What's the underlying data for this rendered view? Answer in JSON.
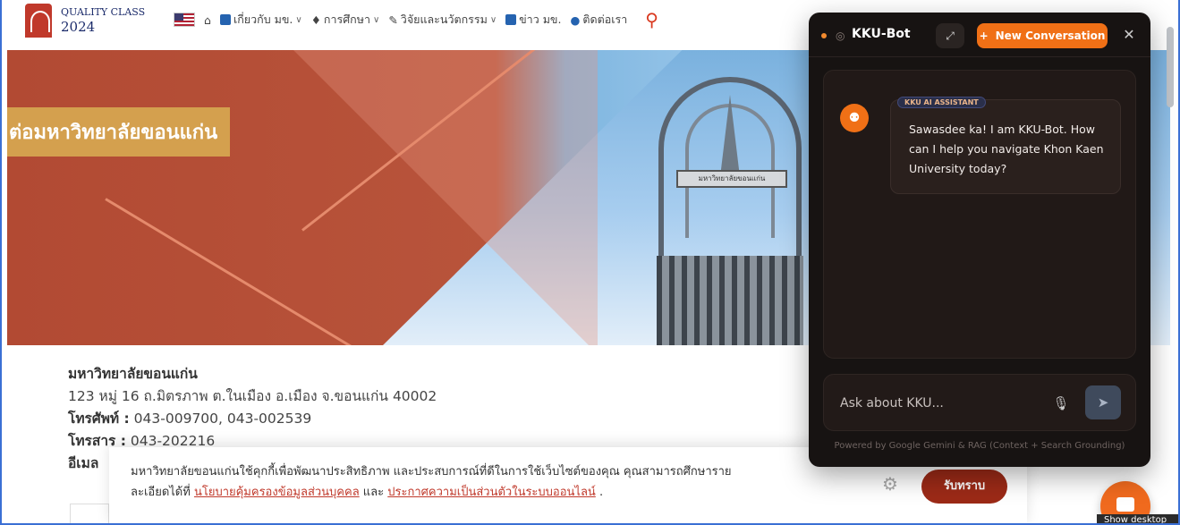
{
  "header": {
    "logo_quality": "QUALITY CLASS",
    "logo_year": "2024",
    "nav": [
      {
        "label": "เกี่ยวกับ มข.",
        "has_dropdown": true
      },
      {
        "label": "การศึกษา",
        "has_dropdown": true
      },
      {
        "label": "วิจัยและนวัตกรรม",
        "has_dropdown": true
      },
      {
        "label": "ข่าว มข.",
        "has_dropdown": false
      },
      {
        "label": "ติดต่อเรา",
        "has_dropdown": false
      }
    ],
    "icons": [
      "us-flag-icon",
      "home-icon",
      "search-icon"
    ]
  },
  "hero": {
    "title": "ต่อมหาวิทยาลัยขอนแก่น",
    "monument_plate": "มหาวิทยาลัยขอนแก่น"
  },
  "address": {
    "name": "มหาวิทยาลัยขอนแก่น",
    "line1": "123 หมู่ 16 ถ.มิตรภาพ ต.ในเมือง อ.เมือง จ.ขอนแก่น 40002",
    "phone_label": "โทรศัพท์ :",
    "phone": " 043-009700, 043-002539",
    "fax_label": "โทรสาร :",
    "fax": " 043-202216",
    "email_label": "อีเมล"
  },
  "cookie": {
    "text_a": "มหาวิทยาลัยขอนแก่นใช้คุกกี้เพื่อพัฒนาประสิทธิภาพ และประสบการณ์ที่ดีในการใช้เว็บไซต์ของคุณ คุณสามารถศึกษาราย",
    "text_b": "ละเอียดได้ที่ ",
    "link1": "นโยบายคุ้มครองข้อมูลส่วนบุคคล",
    "text_c": " และ ",
    "link2": "ประกาศความเป็นส่วนตัวในระบบออนไลน์",
    "text_d": " .",
    "accept_label": "รับทราบ"
  },
  "chat": {
    "title": "KKU-Bot",
    "new_conversation": "New Conversation",
    "assistant_label": "KKU AI ASSISTANT",
    "message": "Sawasdee ka! I am KKU-Bot. How can I help you navigate Khon Kaen University today?",
    "input_placeholder": "Ask about KKU...",
    "powered_by": "Powered by Google Gemini & RAG (Context + Search Grounding)",
    "accent_color": "#f07016"
  },
  "tooltip": "Show desktop"
}
